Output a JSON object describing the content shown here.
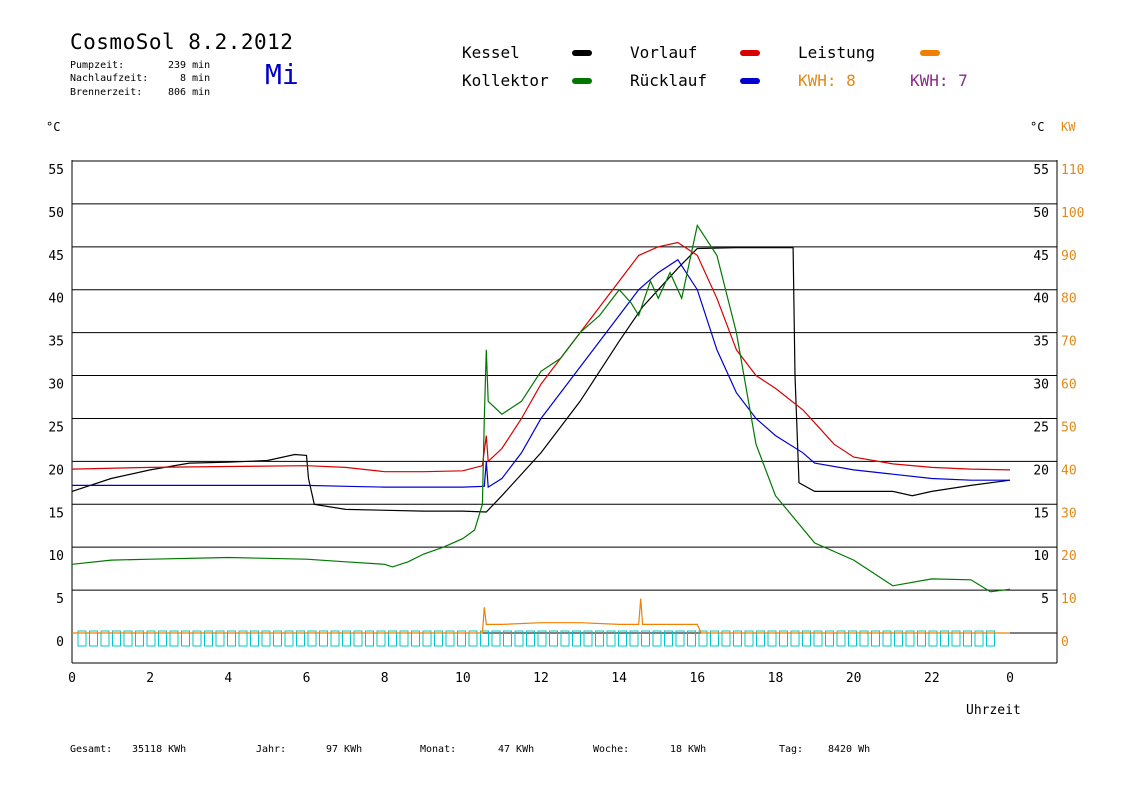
{
  "header": {
    "title": "CosmoSol 8.2.2012",
    "pumpzeit_label": "Pumpzeit:",
    "pumpzeit_value": "239 min",
    "nachlauf_label": "Nachlaufzeit:",
    "nachlauf_value": "8 min",
    "brenner_label": "Brennerzeit:",
    "brenner_value": "806 min",
    "weekday": "Mi"
  },
  "legend": {
    "kessel": "Kessel",
    "kollektor": "Kollektor",
    "vorlauf": "Vorlauf",
    "ruecklauf": "Rücklauf",
    "leistung": "Leistung",
    "kwh1": "KWH: 8",
    "kwh2": "KWH: 7"
  },
  "footer": {
    "gesamt_label": "Gesamt:",
    "gesamt_value": "35118 KWh",
    "jahr_label": "Jahr:",
    "jahr_value": "97 KWh",
    "monat_label": "Monat:",
    "monat_value": "47 KWh",
    "woche_label": "Woche:",
    "woche_value": "18 KWh",
    "tag_label": "Tag:",
    "tag_value": "8420 Wh"
  },
  "colors": {
    "kessel": "#000000",
    "kollektor": "#007800",
    "vorlauf": "#d80000",
    "ruecklauf": "#0000d0",
    "leistung": "#f08000",
    "purple": "#8a2a8a",
    "cyan": "#00c8c8"
  },
  "chart_data": {
    "type": "line",
    "title": "CosmoSol 8.2.2012",
    "xlabel": "Uhrzeit",
    "ylabel_left": "°C",
    "ylabel_right": "°C",
    "ylabel_right2": "KW",
    "xlim": [
      0,
      24
    ],
    "ylim": [
      0,
      55
    ],
    "x_ticks": [
      "0",
      "2",
      "4",
      "6",
      "8",
      "10",
      "12",
      "14",
      "16",
      "18",
      "20",
      "22",
      "0"
    ],
    "y_ticks_left": [
      "0",
      "5",
      "10",
      "15",
      "20",
      "25",
      "30",
      "35",
      "40",
      "45",
      "50",
      "55"
    ],
    "y_ticks_right": [
      "5",
      "10",
      "15",
      "20",
      "25",
      "30",
      "35",
      "40",
      "45",
      "50",
      "55"
    ],
    "kw_ticks": [
      "0",
      "10",
      "20",
      "30",
      "40",
      "50",
      "60",
      "70",
      "80",
      "90",
      "100",
      "110"
    ],
    "grid": true,
    "series": [
      {
        "name": "Kessel",
        "color": "#000000",
        "points": [
          [
            0,
            16.5
          ],
          [
            1,
            18
          ],
          [
            2,
            19
          ],
          [
            3,
            19.8
          ],
          [
            4,
            19.9
          ],
          [
            5,
            20.1
          ],
          [
            5.7,
            20.8
          ],
          [
            6,
            20.7
          ],
          [
            6.05,
            18
          ],
          [
            6.2,
            15
          ],
          [
            7,
            14.4
          ],
          [
            9,
            14.2
          ],
          [
            10,
            14.2
          ],
          [
            10.6,
            14.1
          ],
          [
            11,
            16
          ],
          [
            12,
            21
          ],
          [
            13,
            27
          ],
          [
            14,
            34
          ],
          [
            14.6,
            38
          ],
          [
            15,
            40
          ],
          [
            15.5,
            42.5
          ],
          [
            16,
            44.8
          ],
          [
            17,
            44.9
          ],
          [
            18,
            44.9
          ],
          [
            18.45,
            44.9
          ],
          [
            18.5,
            30
          ],
          [
            18.6,
            17.5
          ],
          [
            19,
            16.5
          ],
          [
            21,
            16.5
          ],
          [
            21.5,
            16
          ],
          [
            22,
            16.5
          ],
          [
            23,
            17.2
          ],
          [
            24,
            17.8
          ]
        ]
      },
      {
        "name": "Vorlauf",
        "color": "#d80000",
        "points": [
          [
            0,
            19.1
          ],
          [
            2,
            19.3
          ],
          [
            4,
            19.4
          ],
          [
            6,
            19.5
          ],
          [
            7,
            19.3
          ],
          [
            8,
            18.8
          ],
          [
            9,
            18.8
          ],
          [
            10,
            18.9
          ],
          [
            10.5,
            19.5
          ],
          [
            10.6,
            23
          ],
          [
            10.65,
            20
          ],
          [
            11,
            21.5
          ],
          [
            11.5,
            25
          ],
          [
            12,
            29
          ],
          [
            13,
            35
          ],
          [
            14,
            41
          ],
          [
            14.5,
            44
          ],
          [
            15,
            45
          ],
          [
            15.5,
            45.5
          ],
          [
            16,
            44
          ],
          [
            16.5,
            39
          ],
          [
            17,
            33
          ],
          [
            17.5,
            30
          ],
          [
            18,
            28.5
          ],
          [
            18.7,
            26
          ],
          [
            19,
            24.5
          ],
          [
            19.5,
            22
          ],
          [
            20,
            20.5
          ],
          [
            21,
            19.7
          ],
          [
            22,
            19.3
          ],
          [
            23,
            19.1
          ],
          [
            24,
            19.0
          ]
        ]
      },
      {
        "name": "Rücklauf",
        "color": "#0000d0",
        "points": [
          [
            0,
            17.2
          ],
          [
            2,
            17.2
          ],
          [
            4,
            17.2
          ],
          [
            6,
            17.2
          ],
          [
            7,
            17.1
          ],
          [
            8,
            17.0
          ],
          [
            10,
            17.0
          ],
          [
            10.55,
            17.1
          ],
          [
            10.6,
            20
          ],
          [
            10.65,
            17
          ],
          [
            11,
            18
          ],
          [
            11.5,
            21
          ],
          [
            12,
            25
          ],
          [
            13,
            31
          ],
          [
            14,
            37
          ],
          [
            14.5,
            40
          ],
          [
            15,
            42
          ],
          [
            15.5,
            43.5
          ],
          [
            16,
            40
          ],
          [
            16.5,
            33
          ],
          [
            17,
            28
          ],
          [
            17.5,
            25
          ],
          [
            18,
            23
          ],
          [
            18.7,
            21
          ],
          [
            19,
            19.8
          ],
          [
            20,
            19
          ],
          [
            21,
            18.5
          ],
          [
            22,
            18
          ],
          [
            23,
            17.8
          ],
          [
            24,
            17.8
          ]
        ]
      },
      {
        "name": "Kollektor",
        "color": "#007800",
        "points": [
          [
            0,
            8
          ],
          [
            1,
            8.5
          ],
          [
            2,
            8.6
          ],
          [
            4,
            8.8
          ],
          [
            6,
            8.6
          ],
          [
            7,
            8.3
          ],
          [
            8,
            8
          ],
          [
            8.2,
            7.7
          ],
          [
            8.6,
            8.3
          ],
          [
            9,
            9.2
          ],
          [
            9.5,
            10
          ],
          [
            10,
            11
          ],
          [
            10.3,
            12
          ],
          [
            10.5,
            15
          ],
          [
            10.55,
            25
          ],
          [
            10.6,
            33
          ],
          [
            10.65,
            27
          ],
          [
            11,
            25.5
          ],
          [
            11.5,
            27
          ],
          [
            12,
            30.5
          ],
          [
            12.5,
            32
          ],
          [
            13,
            35
          ],
          [
            13.5,
            37
          ],
          [
            14,
            40
          ],
          [
            14.3,
            38.5
          ],
          [
            14.5,
            37
          ],
          [
            14.8,
            41
          ],
          [
            15,
            39
          ],
          [
            15.3,
            42
          ],
          [
            15.6,
            39
          ],
          [
            16,
            47.5
          ],
          [
            16.5,
            44
          ],
          [
            17,
            35
          ],
          [
            17.5,
            22
          ],
          [
            18,
            16
          ],
          [
            19,
            10.5
          ],
          [
            20,
            8.5
          ],
          [
            20.5,
            7
          ],
          [
            21,
            5.5
          ],
          [
            22,
            6.3
          ],
          [
            23,
            6.2
          ],
          [
            23.5,
            4.8
          ],
          [
            24,
            5.1
          ]
        ]
      },
      {
        "name": "Leistung",
        "color": "#f08000",
        "points": [
          [
            0,
            0
          ],
          [
            10.5,
            0
          ],
          [
            10.55,
            3
          ],
          [
            10.6,
            1
          ],
          [
            11,
            1
          ],
          [
            12,
            1.2
          ],
          [
            13,
            1.2
          ],
          [
            14,
            1
          ],
          [
            14.5,
            1
          ],
          [
            14.55,
            4
          ],
          [
            14.6,
            1
          ],
          [
            16,
            1
          ],
          [
            16.1,
            0
          ],
          [
            24,
            0
          ]
        ]
      }
    ]
  }
}
